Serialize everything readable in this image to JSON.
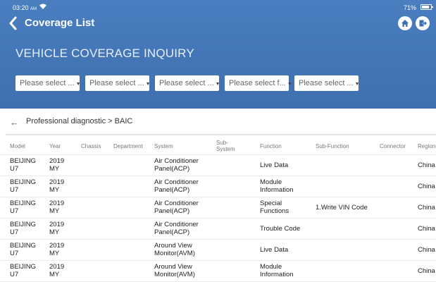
{
  "status": {
    "time": "03:20",
    "ampm": "AM",
    "battery": "71%"
  },
  "header": {
    "title": "Coverage List"
  },
  "inquiry": {
    "title": "VEHICLE COVERAGE INQUIRY",
    "selects": [
      "Please select ...",
      "Please select ...",
      "Please select ...",
      "Please select f...",
      "Please select ..."
    ]
  },
  "breadcrumb": "Professional diagnostic > BAIC",
  "table": {
    "columns": [
      {
        "label": "Model"
      },
      {
        "label": "Year"
      },
      {
        "label": "Chassis"
      },
      {
        "label": "Department"
      },
      {
        "label": "System"
      },
      {
        "label": "Sub-",
        "label2": "System"
      },
      {
        "label": "Function"
      },
      {
        "label": "Sub-Function"
      },
      {
        "label": "Connector"
      },
      {
        "label": "Region"
      }
    ],
    "rows": [
      {
        "model": [
          "BEIJING",
          "U7"
        ],
        "year": [
          "2019",
          "MY"
        ],
        "system": [
          "Air Conditioner",
          "Panel(ACP)"
        ],
        "function": [
          "Live Data"
        ],
        "subfunction": "",
        "region": "China"
      },
      {
        "model": [
          "BEIJING",
          "U7"
        ],
        "year": [
          "2019",
          "MY"
        ],
        "system": [
          "Air Conditioner",
          "Panel(ACP)"
        ],
        "function": [
          "Module",
          "Information"
        ],
        "subfunction": "",
        "region": "China"
      },
      {
        "model": [
          "BEIJING",
          "U7"
        ],
        "year": [
          "2019",
          "MY"
        ],
        "system": [
          "Air Conditioner",
          "Panel(ACP)"
        ],
        "function": [
          "Special",
          "Functions"
        ],
        "subfunction": "1.Write VIN Code",
        "region": "China"
      },
      {
        "model": [
          "BEIJING",
          "U7"
        ],
        "year": [
          "2019",
          "MY"
        ],
        "system": [
          "Air Conditioner",
          "Panel(ACP)"
        ],
        "function": [
          "Trouble Code"
        ],
        "subfunction": "",
        "region": "China"
      },
      {
        "model": [
          "BEIJING",
          "U7"
        ],
        "year": [
          "2019",
          "MY"
        ],
        "system": [
          "Around View",
          "Monitor(AVM)"
        ],
        "function": [
          "Live Data"
        ],
        "subfunction": "",
        "region": "China"
      },
      {
        "model": [
          "BEIJING",
          "U7"
        ],
        "year": [
          "2019",
          "MY"
        ],
        "system": [
          "Around View",
          "Monitor(AVM)"
        ],
        "function": [
          "Module",
          "Information"
        ],
        "subfunction": "",
        "region": "China"
      }
    ]
  },
  "colors": {
    "header": "#4475b8",
    "accent_text": "#e6eef8"
  }
}
